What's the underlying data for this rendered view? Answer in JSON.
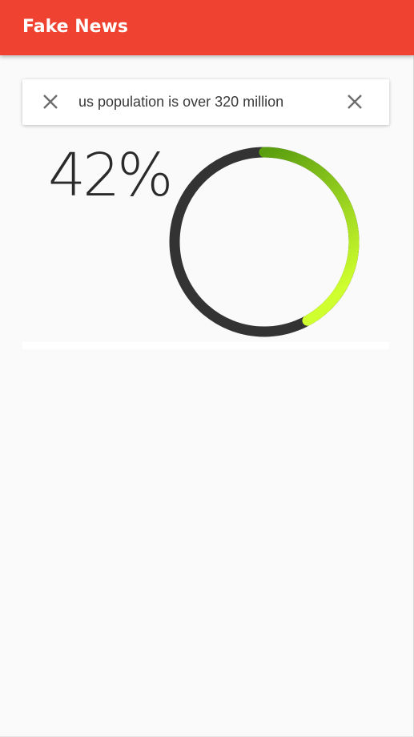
{
  "appbar": {
    "title": "Fake News"
  },
  "search": {
    "query": "us population is over 320 million",
    "clear_icon": "close-icon",
    "dismiss_icon": "close-icon"
  },
  "result": {
    "percent_label": "42%",
    "percent_value": 42
  },
  "colors": {
    "appbar": "#ef4230",
    "gauge_track": "#333333",
    "gauge_fill_start": "#5a9e0f",
    "gauge_fill_end": "#cfff2e",
    "background": "#fafafa"
  }
}
